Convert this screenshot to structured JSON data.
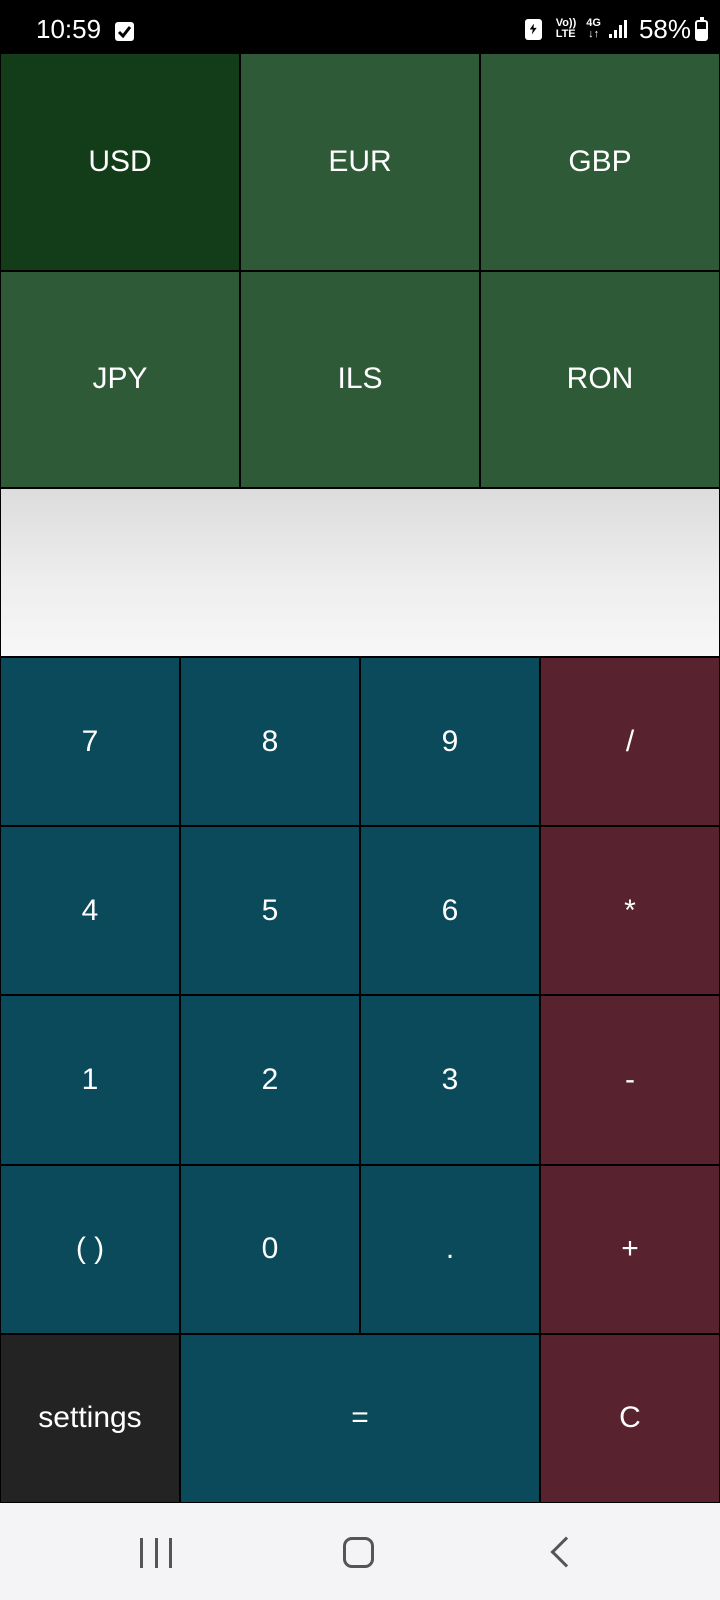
{
  "status_bar": {
    "time": "10:59",
    "volte_top": "Vo))",
    "volte_bottom": "LTE",
    "network_top": "4G",
    "network_bottom": "↓↑",
    "battery_percent": "58%",
    "battery_level": 0.58,
    "icons": [
      "checkbox-notification-icon",
      "battery-saver-icon",
      "volte-icon",
      "4g-icon",
      "signal-icon",
      "battery-icon"
    ]
  },
  "currencies": [
    {
      "code": "USD",
      "selected": true
    },
    {
      "code": "EUR",
      "selected": false
    },
    {
      "code": "GBP",
      "selected": false
    },
    {
      "code": "JPY",
      "selected": false
    },
    {
      "code": "ILS",
      "selected": false
    },
    {
      "code": "RON",
      "selected": false
    }
  ],
  "display": {
    "value": ""
  },
  "keypad": {
    "k7": "7",
    "k8": "8",
    "k9": "9",
    "divide": "/",
    "k4": "4",
    "k5": "5",
    "k6": "6",
    "multiply": "*",
    "k1": "1",
    "k2": "2",
    "k3": "3",
    "minus": "-",
    "parens": "( )",
    "k0": "0",
    "dot": ".",
    "plus": "+",
    "settings": "settings",
    "equals": "=",
    "clear": "C"
  },
  "colors": {
    "currency_bg": "#2e5a37",
    "currency_selected_bg": "#133d18",
    "digit_bg": "#0a4a5a",
    "operator_bg": "#58222e",
    "settings_bg": "#232323"
  },
  "nav_bar": {
    "icons": [
      "recents-icon",
      "home-icon",
      "back-icon"
    ]
  }
}
